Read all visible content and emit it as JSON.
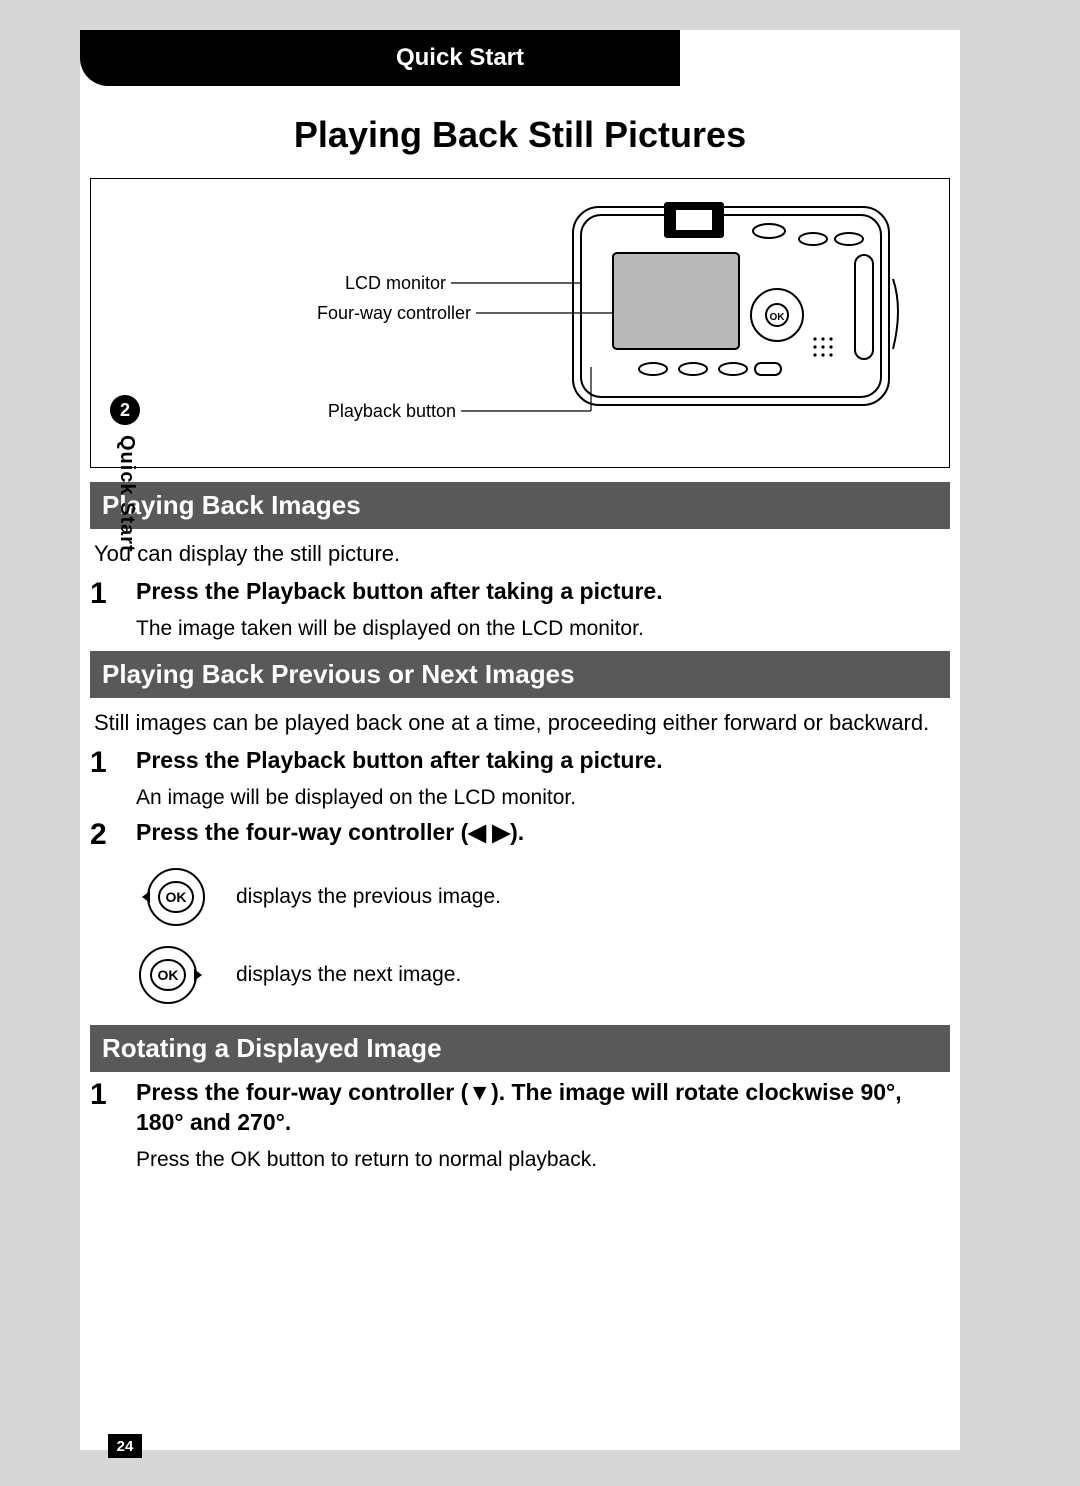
{
  "gutter": {
    "chapter_number": "2",
    "chapter_label": "Quick Start",
    "page_number": "24"
  },
  "topbar": {
    "label": "Quick Start"
  },
  "title": "Playing Back Still Pictures",
  "diagram": {
    "label_lcd": "LCD monitor",
    "label_fourway": "Four-way controller",
    "label_playback": "Playback button"
  },
  "section1": {
    "heading": "Playing Back Images",
    "intro": "You can display the still picture.",
    "steps": [
      {
        "num": "1",
        "title": "Press the Playback button after taking a picture.",
        "desc": "The image taken will be displayed on the LCD monitor."
      }
    ]
  },
  "section2": {
    "heading": "Playing Back Previous or Next Images",
    "intro": "Still images can be played back one at a time, proceeding either forward or backward.",
    "steps": [
      {
        "num": "1",
        "title": "Press the Playback button after taking a picture.",
        "desc": "An image will be displayed on the LCD monitor."
      },
      {
        "num": "2",
        "title": "Press the four-way controller (◀ ▶).",
        "prev_text": "displays the previous image.",
        "next_text": "displays the next image."
      }
    ]
  },
  "section3": {
    "heading": "Rotating a Displayed Image",
    "steps": [
      {
        "num": "1",
        "title": "Press the four-way controller (▼). The image will rotate clockwise 90°, 180° and 270°.",
        "desc": "Press the OK button to return to normal playback."
      }
    ]
  }
}
